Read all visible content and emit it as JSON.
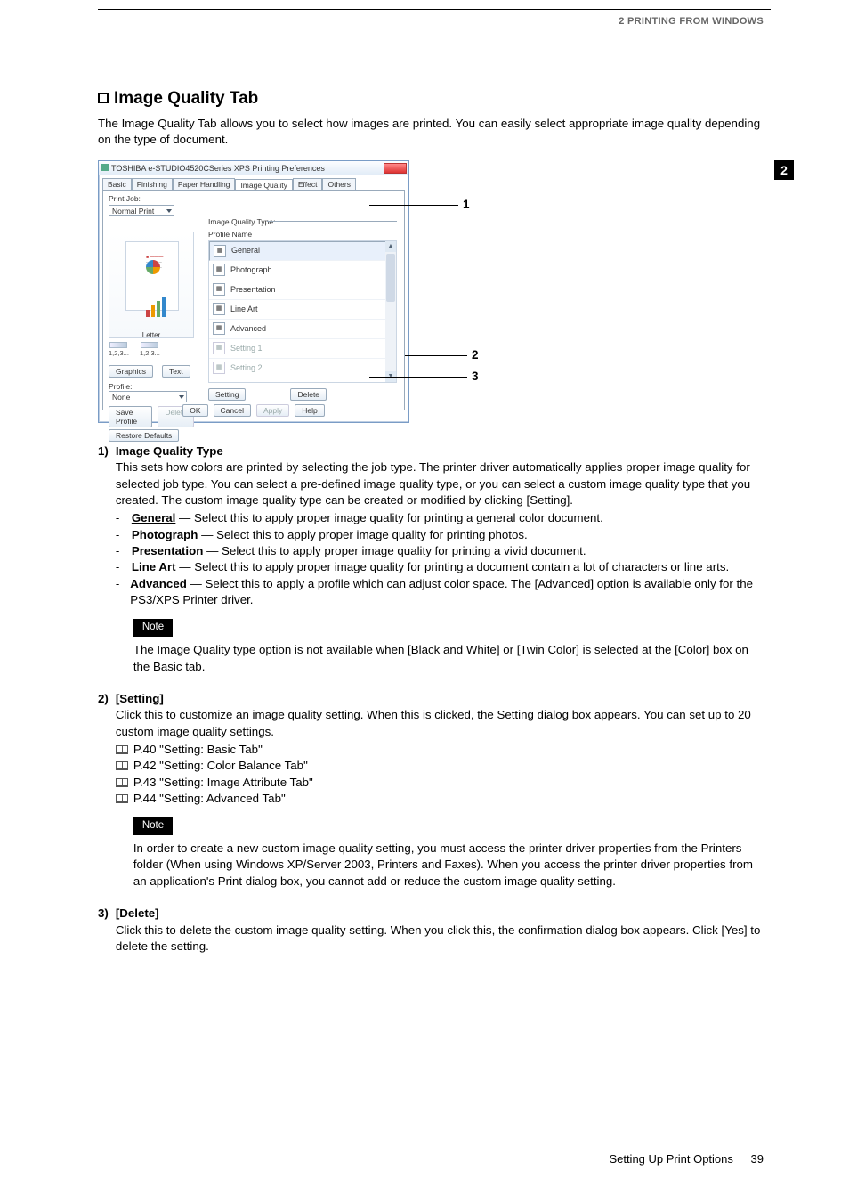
{
  "header": {
    "section": "2 PRINTING FROM WINDOWS",
    "chapter_tab": "2"
  },
  "title": "Image Quality Tab",
  "intro": "The Image Quality Tab allows you to select how images are printed.  You can easily select appropriate image quality depending on the type of document.",
  "dialog": {
    "title": "TOSHIBA e-STUDIO4520CSeries XPS Printing Preferences",
    "tabs": [
      "Basic",
      "Finishing",
      "Paper Handling",
      "Image Quality",
      "Effect",
      "Others"
    ],
    "active_tab_index": 3,
    "print_job_label": "Print Job:",
    "print_job_value": "Normal Print",
    "preview_label": "Letter",
    "scale_left": "1,2,3...",
    "scale_right": "1,2,3...",
    "btn_graphics": "Graphics",
    "btn_text": "Text",
    "profile_label": "Profile:",
    "profile_value": "None",
    "btn_save_profile": "Save Profile",
    "btn_delete_profile": "Delete",
    "btn_restore": "Restore Defaults",
    "iql_header": "Image Quality Type:",
    "iql_sub": "Profile Name",
    "iql_items": [
      "General",
      "Photograph",
      "Presentation",
      "Line Art",
      "Advanced",
      "Setting 1",
      "Setting 2"
    ],
    "btn_setting": "Setting",
    "btn_delete": "Delete",
    "btn_ok": "OK",
    "btn_cancel": "Cancel",
    "btn_apply": "Apply",
    "btn_help": "Help"
  },
  "callouts": {
    "c1": "1",
    "c2": "2",
    "c3": "3"
  },
  "items": [
    {
      "num": "1)",
      "lead": "Image Quality Type",
      "body": "This sets how colors are printed by selecting the job type.  The printer driver automatically applies proper image quality for selected job type.  You can select a pre-defined image quality type, or you can select a custom image quality type that you created.  The custom image quality type can be created or modified by clicking [Setting].",
      "subs": [
        {
          "term": "General",
          "underline": true,
          "text": " — Select this to apply proper image quality for printing a general color document."
        },
        {
          "term": "Photograph",
          "text": " — Select this to apply proper image quality for printing photos."
        },
        {
          "term": "Presentation",
          "text": " — Select this to apply proper image quality for printing a vivid document."
        },
        {
          "term": "Line Art",
          "text": " — Select this to apply proper image quality for printing a document contain a lot of characters or line arts."
        },
        {
          "term": "Advanced",
          "text": " — Select this to apply a profile which can adjust color space. The [Advanced] option is available only for the PS3/XPS Printer driver."
        }
      ],
      "note_label": "Note",
      "note": "The Image Quality type option is not available when [Black and White] or [Twin Color] is selected at the [Color] box on the Basic tab."
    },
    {
      "num": "2)",
      "lead": "[Setting]",
      "body": "Click this to customize an image quality setting.  When this is clicked, the Setting dialog box appears.  You can set up to 20 custom image quality settings.",
      "xrefs": [
        "P.40 \"Setting: Basic Tab\"",
        "P.42 \"Setting: Color Balance Tab\"",
        "P.43 \"Setting: Image Attribute Tab\"",
        "P.44 \"Setting: Advanced Tab\""
      ],
      "note_label": "Note",
      "note": "In order to create a new custom image quality setting, you must access the printer driver properties from the Printers folder (When using Windows XP/Server 2003, Printers and Faxes).  When you access the printer driver properties from an application's Print dialog box, you  cannot add or reduce the custom image quality setting."
    },
    {
      "num": "3)",
      "lead": "[Delete]",
      "body": "Click this to delete the custom image quality setting.  When you click this, the confirmation dialog box appears. Click [Yes] to delete the setting."
    }
  ],
  "footer": {
    "text": "Setting Up Print Options",
    "page": "39"
  }
}
